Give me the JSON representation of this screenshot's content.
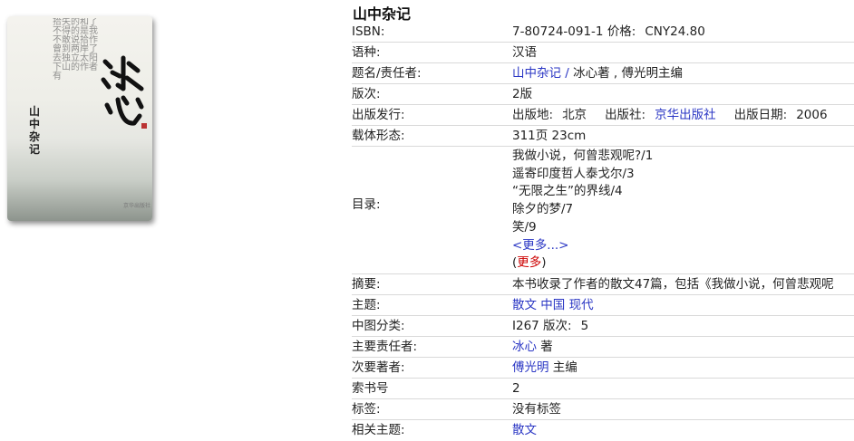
{
  "cover": {
    "calligraphy_title": "冰心",
    "vertical_title": "山中杂记",
    "background_text": "拾失的和了不得的是我不敢说拾作曾到两岸了去独立太阳下山的作者有",
    "publisher_mark": "京华出版社"
  },
  "book": {
    "title": "山中杂记"
  },
  "fields": {
    "isbn": {
      "label": "ISBN:",
      "value": "7-80724-091-1",
      "price_label": "价格:",
      "price": "CNY24.80"
    },
    "language": {
      "label": "语种:",
      "value": "汉语"
    },
    "title_resp": {
      "label": "题名/责任者:",
      "title_link": "山中杂记",
      "sep": " / ",
      "rest": "冰心著 , 傅光明主编"
    },
    "edition": {
      "label": "版次:",
      "value": "2版"
    },
    "publication": {
      "label": "出版发行:",
      "place_label": "出版地:",
      "place": "北京",
      "publisher_label": "出版社:",
      "publisher": "京华出版社",
      "date_label": "出版日期:",
      "date": "2006"
    },
    "physical": {
      "label": "载体形态:",
      "value": "311页 23cm"
    },
    "contents": {
      "label": "目录:",
      "items": [
        "我做小说，何曾悲观呢?/1",
        "遥寄印度哲人泰戈尔/3",
        "“无限之生”的界线/4",
        "除夕的梦/7",
        "笑/9"
      ],
      "more_link": "<更多...>",
      "more_open": "(",
      "more_red": "更多",
      "more_close": ")"
    },
    "abstract": {
      "label": "摘要:",
      "value": "本书收录了作者的散文47篇，包括《我做小说，何曾悲观呢"
    },
    "subject": {
      "label": "主题:",
      "links": [
        "散文",
        "中国",
        "现代"
      ]
    },
    "classification": {
      "label": "中图分类:",
      "value": "I267",
      "edition_label": "版次:",
      "edition": "5"
    },
    "primary_author": {
      "label": "主要责任者:",
      "name": "冰心",
      "role": "著"
    },
    "secondary_author": {
      "label": "次要著者:",
      "name": "傅光明",
      "role": "主编"
    },
    "call_number": {
      "label": "索书号",
      "value": "2"
    },
    "tags": {
      "label": "标签:",
      "value": "没有标签"
    },
    "related_subject": {
      "label": "相关主题:",
      "value": "散文"
    }
  }
}
